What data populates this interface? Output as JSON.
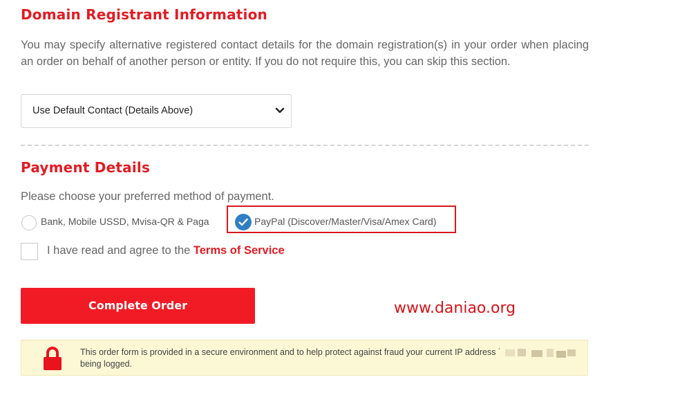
{
  "domain_registrant": {
    "title": "Domain Registrant Information",
    "description": "You may specify alternative registered contact details for the domain registration(s) in your order when placing an order on behalf of another person or entity. If you do not require this, you can skip this section.",
    "contact_select_value": "Use Default Contact (Details Above)"
  },
  "payment": {
    "title": "Payment Details",
    "description": "Please choose your preferred method of payment.",
    "options": [
      {
        "label": "Bank, Mobile USSD, Mvisa-QR & Paga",
        "selected": false
      },
      {
        "label": "PayPal (Discover/Master/Visa/Amex Card)",
        "selected": true
      }
    ]
  },
  "tos": {
    "text": "I have read and agree to the ",
    "link": "Terms of Service"
  },
  "complete_button": "Complete Order",
  "watermark": "www.daniao.org",
  "secure_notice": {
    "text": "This order form is provided in a secure environment and to help protect against fraud your current IP address is being logged."
  },
  "colors": {
    "accent_red": "#e21b23",
    "button_red": "#f01b25",
    "check_blue": "#2f7fc4",
    "notice_bg": "#fcf7d5"
  },
  "icons": [
    "chevron-down-icon",
    "checkmark-icon",
    "lock-icon"
  ]
}
